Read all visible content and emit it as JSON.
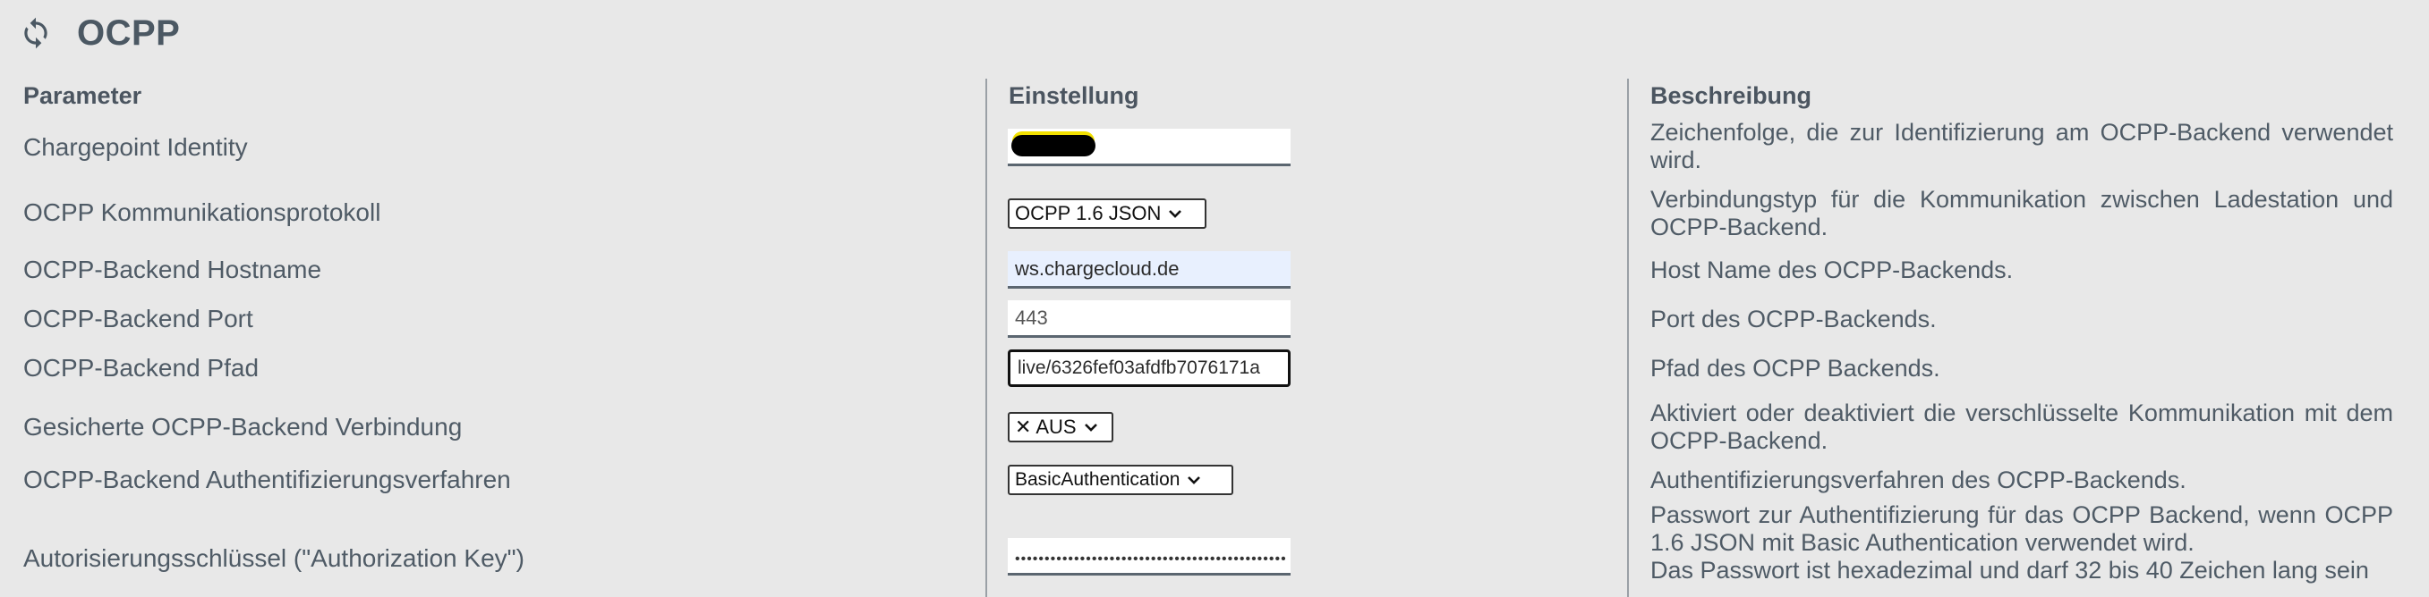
{
  "title": "OCPP",
  "headers": {
    "parameter": "Parameter",
    "setting": "Einstellung",
    "description": "Beschreibung"
  },
  "rows": [
    {
      "label": "Chargepoint Identity",
      "value": "",
      "description": "Zeichenfolge, die zur Identifizierung am OCPP-Backend verwendet wird."
    },
    {
      "label": "OCPP Kommunikationsprotokoll",
      "value": "OCPP 1.6 JSON",
      "description": "Verbindungstyp für die Kommunikation zwischen Ladestation und OCPP-Backend."
    },
    {
      "label": "OCPP-Backend Hostname",
      "value": "ws.chargecloud.de",
      "description": "Host Name des OCPP-Backends."
    },
    {
      "label": "OCPP-Backend Port",
      "value": "443",
      "description": "Port des OCPP-Backends."
    },
    {
      "label": "OCPP-Backend Pfad",
      "value": "live/6326fef03afdfb7076171a",
      "description": "Pfad des OCPP Backends."
    },
    {
      "label": "Gesicherte OCPP-Backend Verbindung",
      "value": "✕ AUS",
      "description": "Aktiviert oder deaktiviert die verschlüsselte Kommunikation mit dem OCPP-Backend."
    },
    {
      "label": "OCPP-Backend Authentifizierungsverfahren",
      "value": "BasicAuthentication",
      "description": "Authentifizierungsverfahren des OCPP-Backends."
    },
    {
      "label": "Autorisierungsschlüssel (\"Authorization Key\")",
      "value": "••••••••••••••••••••••••••••••••••••••••••••••••",
      "description": "Passwort zur Authentifizierung für das OCPP Backend, wenn OCPP 1.6 JSON mit Basic Authentication verwendet wird.",
      "description_extra": "Das Passwort ist hexadezimal und darf 32 bis 40 Zeichen lang sein"
    }
  ],
  "icons": {
    "title": "sync-icon",
    "dropdown": "chevron-down-icon"
  }
}
